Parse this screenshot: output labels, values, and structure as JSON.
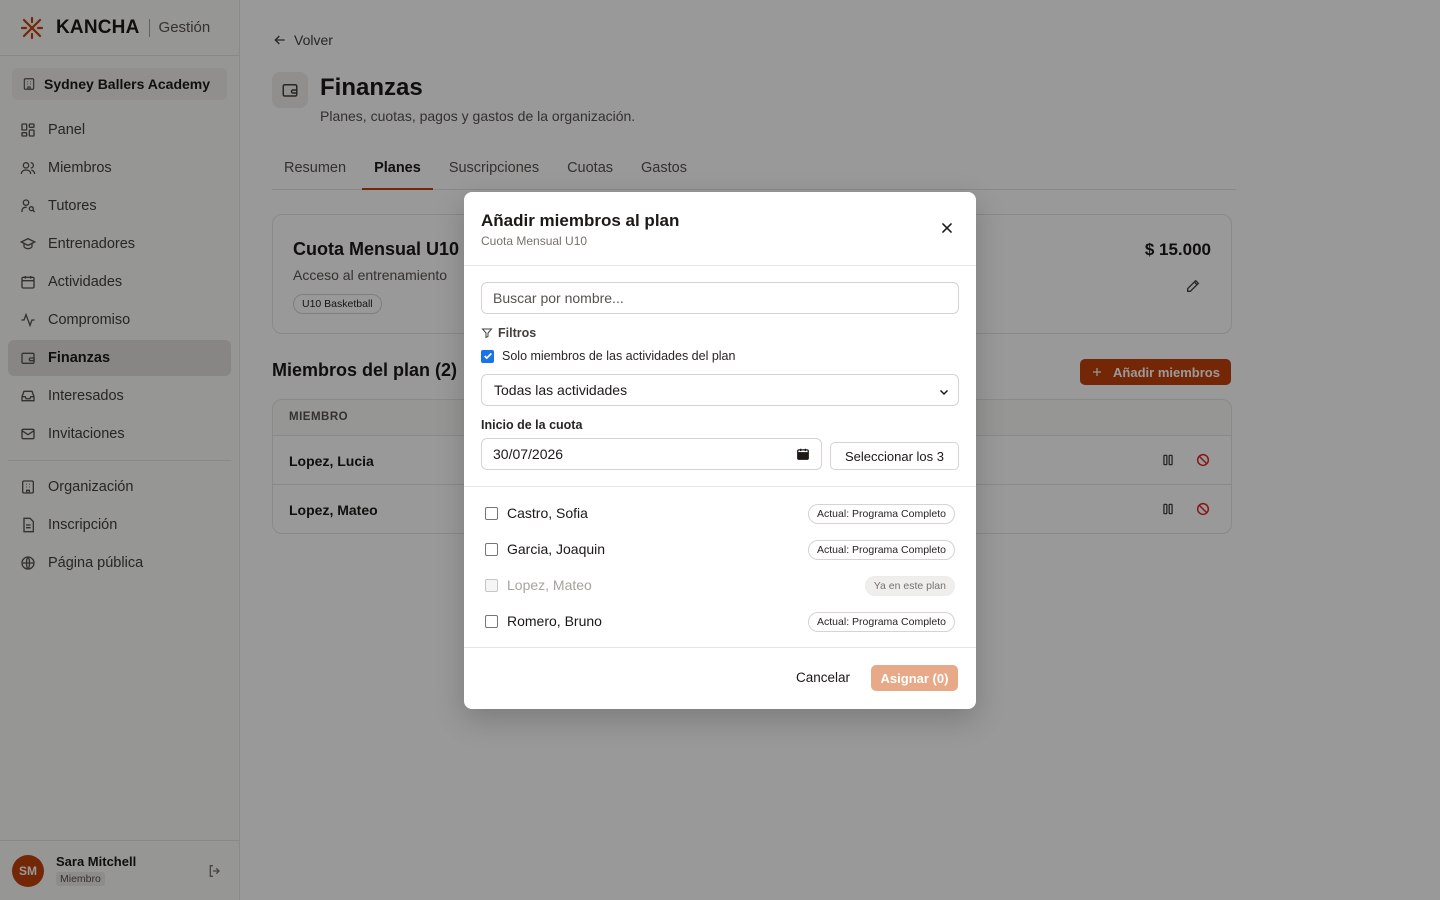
{
  "brand": {
    "name": "KANCHA",
    "sub": "Gestión"
  },
  "sidebar": {
    "org": "Sydney Ballers Academy",
    "items": [
      {
        "label": "Panel",
        "icon": "grid-icon"
      },
      {
        "label": "Miembros",
        "icon": "users-icon"
      },
      {
        "label": "Tutores",
        "icon": "user-key-icon"
      },
      {
        "label": "Entrenadores",
        "icon": "graduation-cap-icon"
      },
      {
        "label": "Actividades",
        "icon": "calendar-icon"
      },
      {
        "label": "Compromiso",
        "icon": "activity-icon"
      },
      {
        "label": "Finanzas",
        "icon": "wallet-icon",
        "active": true
      },
      {
        "label": "Interesados",
        "icon": "inbox-icon"
      },
      {
        "label": "Invitaciones",
        "icon": "mail-icon"
      }
    ],
    "items2": [
      {
        "label": "Organización",
        "icon": "building-icon"
      },
      {
        "label": "Inscripción",
        "icon": "file-icon"
      },
      {
        "label": "Página pública",
        "icon": "globe-icon"
      }
    ],
    "user": {
      "initials": "SM",
      "name": "Sara Mitchell",
      "role": "Miembro"
    }
  },
  "page": {
    "back": "Volver",
    "title": "Finanzas",
    "subtitle": "Planes, cuotas, pagos y gastos de la organización.",
    "tabs": [
      "Resumen",
      "Planes",
      "Suscripciones",
      "Cuotas",
      "Gastos"
    ],
    "active_tab": "Planes"
  },
  "plan": {
    "name": "Cuota Mensual U10",
    "desc": "Acceso al entrenamiento",
    "tag": "U10 Basketball",
    "price": "$ 15.000"
  },
  "members": {
    "title": "Miembros del plan (2)",
    "add_label": "Añadir miembros",
    "column": "MIEMBRO",
    "rows": [
      "Lopez, Lucia",
      "Lopez, Mateo"
    ]
  },
  "modal": {
    "title": "Añadir miembros al plan",
    "subtitle": "Cuota Mensual U10",
    "search_placeholder": "Buscar por nombre...",
    "filters_label": "Filtros",
    "only_plan_label": "Solo miembros de las actividades del plan",
    "only_plan_checked": true,
    "activity_select": "Todas las actividades",
    "date_label": "Inicio de la cuota",
    "date_value": "30/07/2026",
    "select_all": "Seleccionar los 3",
    "list": [
      {
        "name": "Castro, Sofia",
        "badge": "Actual: Programa Completo",
        "disabled": false
      },
      {
        "name": "Garcia, Joaquin",
        "badge": "Actual: Programa Completo",
        "disabled": false
      },
      {
        "name": "Lopez, Mateo",
        "badge": "Ya en este plan",
        "disabled": true
      },
      {
        "name": "Romero, Bruno",
        "badge": "Actual: Programa Completo",
        "disabled": false
      }
    ],
    "cancel": "Cancelar",
    "assign": "Asignar (0)"
  },
  "colors": {
    "accent": "#c2410c",
    "accent_disabled": "#e8a988",
    "danger": "#dc2626"
  }
}
